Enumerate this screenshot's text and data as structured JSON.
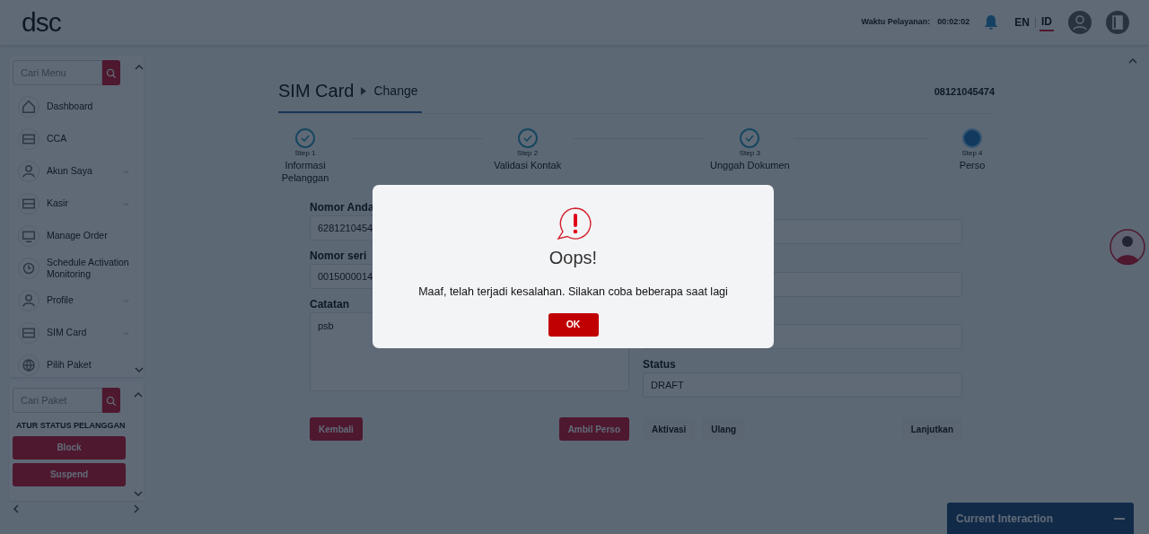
{
  "header": {
    "logo": "dsc",
    "service_time_label": "Waktu Pelayanan:",
    "service_time": "00:02:02",
    "languages": [
      {
        "label": "EN",
        "selected": false
      },
      {
        "label": "ID",
        "selected": true
      }
    ]
  },
  "sidebar": {
    "search": {
      "placeholder": "Cari Menu"
    },
    "items": [
      {
        "label": "Dashboard",
        "has_submenu": false
      },
      {
        "label": "CCA",
        "has_submenu": false
      },
      {
        "label": "Akun Saya",
        "has_submenu": true
      },
      {
        "label": "Kasir",
        "has_submenu": true
      },
      {
        "label": "Manage Order",
        "has_submenu": false
      },
      {
        "label": "Schedule Activation Monitoring",
        "has_submenu": false
      },
      {
        "label": "Profile",
        "has_submenu": true
      },
      {
        "label": "SIM Card",
        "has_submenu": true
      },
      {
        "label": "Pilih Paket",
        "has_submenu": false
      }
    ],
    "package_search": {
      "placeholder": "Cari Paket"
    },
    "status_heading": "ATUR STATUS PELANGGAN",
    "status_buttons": [
      "Block",
      "Suspend"
    ]
  },
  "page": {
    "title": "SIM Card",
    "subtitle": "Change",
    "phone": "08121045474"
  },
  "steps": [
    {
      "caption": "Step 1",
      "label": "Informasi Pelanggan",
      "done": true,
      "selected": false
    },
    {
      "caption": "Step 2",
      "label": "Validasi Kontak",
      "done": true,
      "selected": false
    },
    {
      "caption": "Step 3",
      "label": "Unggah Dokumen",
      "done": true,
      "selected": false
    },
    {
      "caption": "Step 4",
      "label": "Perso",
      "done": false,
      "selected": true
    }
  ],
  "form": {
    "left": [
      {
        "kind": "input",
        "label": "Nomor Anda",
        "value": "6281210454"
      },
      {
        "kind": "input",
        "label": "Nomor seri",
        "value": "0015000014"
      },
      {
        "kind": "textarea",
        "label": "Catatan",
        "value": "psb"
      }
    ],
    "right": [
      {
        "kind": "input"
      },
      {
        "kind": "input"
      },
      {
        "kind": "input"
      },
      {
        "kind": "input",
        "label": "Status",
        "value": "DRAFT"
      }
    ]
  },
  "actions_left": [
    {
      "label": "Kembali",
      "disabled": false
    },
    {
      "label": "Ambil Perso",
      "disabled": false
    }
  ],
  "actions_right": [
    {
      "label": "Aktivasi",
      "disabled": true
    },
    {
      "label": "Ulang",
      "disabled": true
    },
    {
      "label": "Lanjutkan",
      "disabled": true
    }
  ],
  "interaction_panel": {
    "title": "Current Interaction"
  },
  "dialog": {
    "title": "Oops!",
    "message": "Maaf, telah terjadi kesalahan. Silakan coba beberapa saat lagi",
    "button": "OK"
  }
}
